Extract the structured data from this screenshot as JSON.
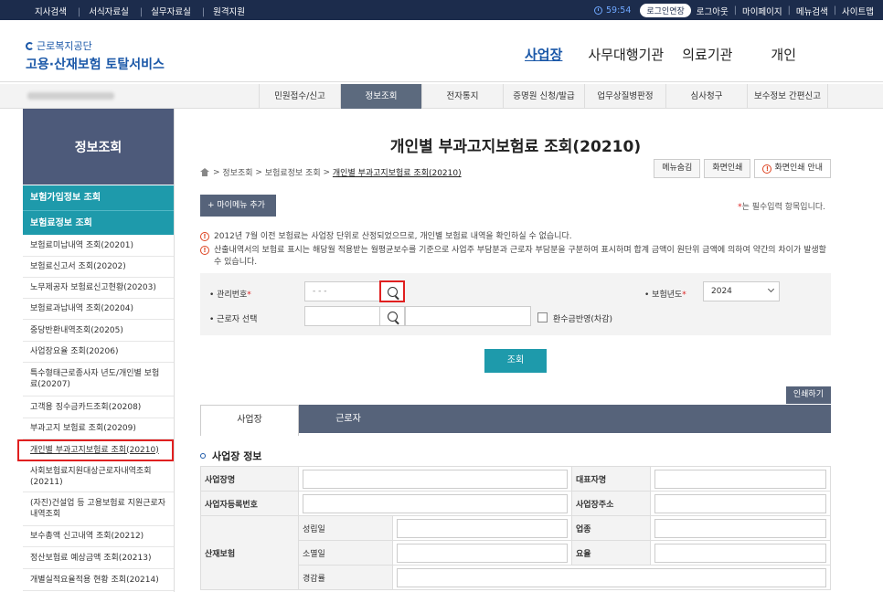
{
  "topbar": {
    "links": [
      "지사검색",
      "서식자료실",
      "실무자료실",
      "원격지원"
    ],
    "timer": "59:54",
    "extend": "로그인연장",
    "right_links": [
      "로그아웃",
      "마이페이지",
      "메뉴검색",
      "사이트맵"
    ]
  },
  "logo": {
    "sub": "근로복지공단",
    "main_bold": "고용·산재보험",
    "main_rest": " 토탈서비스"
  },
  "mainnav": [
    "사업장",
    "사무대행기관",
    "의료기관",
    "개인"
  ],
  "submenu": [
    "민원접수/신고",
    "정보조회",
    "전자통지",
    "증명원 신청/발급",
    "업무상질병판정",
    "심사청구",
    "보수정보 간편신고"
  ],
  "sidebar": {
    "head": "정보조회",
    "group1": "보험가입정보 조회",
    "group2": "보험료정보 조회",
    "items": [
      "보험료미납내역 조회(20201)",
      "보험료신고서 조회(20202)",
      "노무제공자 보험료신고현황(20203)",
      "보험료과납내역 조회(20204)",
      "중당반환내역조회(20205)",
      "사업장요율 조회(20206)",
      "특수형태근로종사자 년도/개인별 보험료(20207)",
      "고객용 징수금카드조회(20208)",
      "부과고지 보험료 조회(20209)",
      "개인별 부과고지보험료 조회(20210)",
      "사회보험료지원대상근로자내역조회 (20211)",
      "(자진)건설업 등 고용보험료 지원근로자 내역조회",
      "보수총액 신고내역 조회(20212)",
      "정산보험료 예상금액 조회(20213)",
      "개별실적요율적용 현황 조회(20214)"
    ]
  },
  "page": {
    "title": "개인별 부과고지보험료 조회(20210)",
    "breadcrumb": [
      "정보조회",
      "보험료정보 조회",
      "개인별 부과고지보험료 조회(20210)"
    ],
    "tools": [
      "메뉴숨김",
      "화면인쇄",
      "화면인쇄 안내"
    ],
    "mymenu": "+ 마이메뉴 추가",
    "required_star": "*",
    "required_note": "는 필수입력 항목입니다.",
    "notices": [
      "2012년 7월 이전 보험료는 사업장 단위로 산정되었으므로, 개인별 보험료 내역을 확인하실 수 없습니다.",
      "산출내역서의 보험료 표시는 해당월 적용받는 월평균보수를 기준으로 사업주 부담분과 근로자 부담분을 구분하여 표시하며 합계 금액이 원단위 금액에 의하여 약간의 차이가 발생할 수 있습니다."
    ]
  },
  "search": {
    "mgmt_label": "관리번호",
    "mgmt_placeholder": "- - -",
    "year_label": "보험년도",
    "year_value": "2024",
    "worker_label": "근로자 선택",
    "refund_label": "환수금반영(차감)",
    "button": "조회"
  },
  "print_button": "인쇄하기",
  "tabs": [
    "사업장",
    "근로자"
  ],
  "section": {
    "title": "사업장 정보",
    "rows": {
      "name": "사업장명",
      "rep": "대표자명",
      "regno": "사업자등록번호",
      "addr": "사업장주소",
      "industrial": "산재보험",
      "established": "성립일",
      "business": "업종",
      "dissolved": "소멸일",
      "rate": "요율",
      "reduction": "경감률"
    }
  }
}
